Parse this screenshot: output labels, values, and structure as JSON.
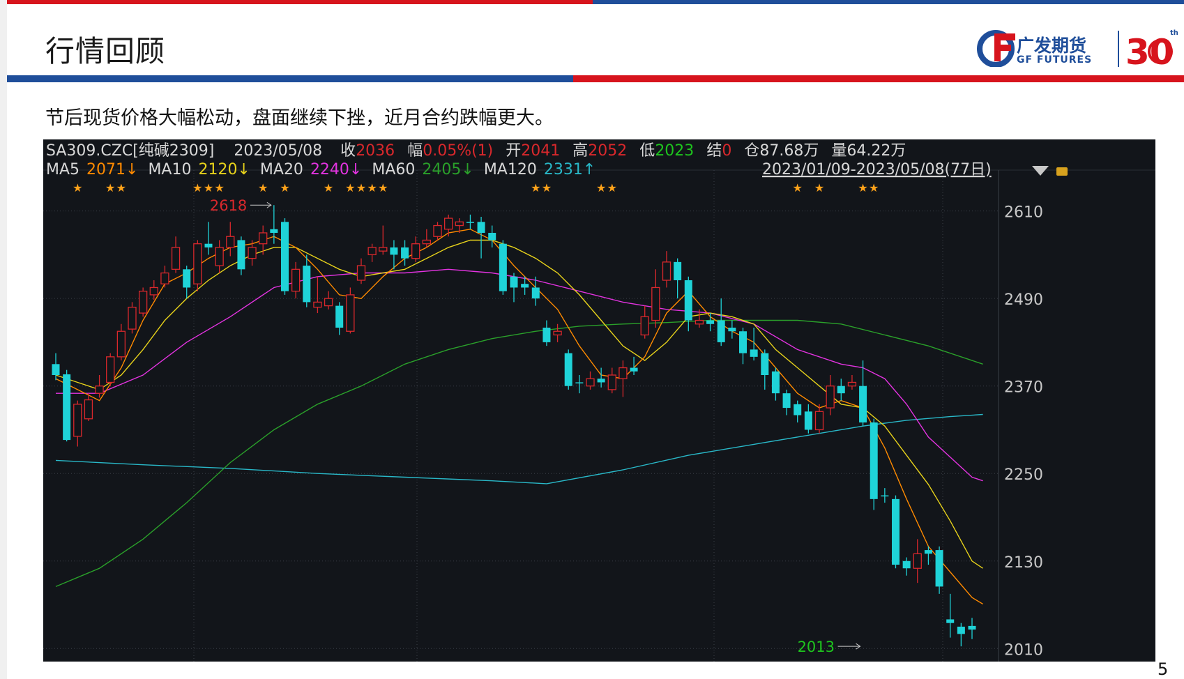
{
  "slide": {
    "title": "行情回顾",
    "subtitle": "节后现货价格大幅松动，盘面继续下挫，近月合约跌幅更大。",
    "page_number": "5",
    "logo_cn": "广发期货",
    "logo_en": "GF FUTURES",
    "logo_30": "30",
    "logo_th": "th"
  },
  "colors": {
    "up": "#d9282c",
    "down": "#1fd3d8",
    "ma5": "#ff8a00",
    "ma10": "#e7d21b",
    "ma20": "#e333e0",
    "ma60": "#2aa02a",
    "ma120": "#29b8c8",
    "text": "#d8d8d8",
    "star": "#ffa21a"
  },
  "chart_data": {
    "type": "candlestick",
    "header": {
      "symbol": "SA309.CZC[纯碱2309]",
      "date": "2023/05/08",
      "close_label": "收",
      "close": "2036",
      "change_label": "幅",
      "change": "0.05%(1)",
      "open_label": "开",
      "open": "2041",
      "high_label": "高",
      "high": "2052",
      "low_label": "低",
      "low": "2023",
      "settle_label": "结",
      "settle": "0",
      "oi_label": "仓",
      "oi": "87.68万",
      "volume_label": "量",
      "volume": "64.22万"
    },
    "ma_legend": [
      {
        "name": "MA5",
        "value": "2071↓",
        "color": "#ff8a00"
      },
      {
        "name": "MA10",
        "value": "2120↓",
        "color": "#e7d21b"
      },
      {
        "name": "MA20",
        "value": "2240↓",
        "color": "#e333e0"
      },
      {
        "name": "MA60",
        "value": "2405↓",
        "color": "#2aa02a"
      },
      {
        "name": "MA120",
        "value": "2331↑",
        "color": "#29b8c8"
      }
    ],
    "range_label": "2023/01/09-2023/05/08(77日)",
    "y_ticks": [
      2610,
      2490,
      2370,
      2250,
      2130,
      2010
    ],
    "ylim": [
      1995,
      2645
    ],
    "annotations": [
      {
        "label": "2618",
        "value": 2618,
        "index": 20
      },
      {
        "label": "2013",
        "value": 2013,
        "index": 74
      }
    ],
    "star_indices": [
      2,
      5,
      6,
      13,
      14,
      15,
      19,
      21,
      25,
      27,
      28,
      29,
      30,
      44,
      45,
      50,
      51,
      68,
      70,
      74,
      75
    ],
    "candles": [
      [
        2400,
        2385,
        2415,
        2378
      ],
      [
        2386,
        2296,
        2392,
        2294
      ],
      [
        2301,
        2345,
        2350,
        2287
      ],
      [
        2325,
        2351,
        2360,
        2322
      ],
      [
        2360,
        2370,
        2385,
        2354
      ],
      [
        2375,
        2410,
        2415,
        2370
      ],
      [
        2410,
        2445,
        2455,
        2405
      ],
      [
        2448,
        2478,
        2485,
        2442
      ],
      [
        2470,
        2500,
        2505,
        2465
      ],
      [
        2495,
        2505,
        2515,
        2488
      ],
      [
        2510,
        2525,
        2535,
        2505
      ],
      [
        2530,
        2560,
        2575,
        2525
      ],
      [
        2530,
        2505,
        2535,
        2490
      ],
      [
        2510,
        2565,
        2570,
        2500
      ],
      [
        2565,
        2560,
        2595,
        2550
      ],
      [
        2535,
        2560,
        2570,
        2525
      ],
      [
        2560,
        2575,
        2595,
        2548
      ],
      [
        2570,
        2530,
        2575,
        2522
      ],
      [
        2545,
        2560,
        2570,
        2535
      ],
      [
        2565,
        2580,
        2590,
        2550
      ],
      [
        2585,
        2580,
        2618,
        2565
      ],
      [
        2595,
        2500,
        2600,
        2495
      ],
      [
        2500,
        2530,
        2540,
        2490
      ],
      [
        2535,
        2485,
        2550,
        2478
      ],
      [
        2478,
        2485,
        2520,
        2470
      ],
      [
        2480,
        2490,
        2500,
        2475
      ],
      [
        2480,
        2450,
        2485,
        2440
      ],
      [
        2445,
        2495,
        2505,
        2442
      ],
      [
        2515,
        2535,
        2545,
        2510
      ],
      [
        2550,
        2560,
        2565,
        2540
      ],
      [
        2555,
        2560,
        2590,
        2550
      ],
      [
        2560,
        2550,
        2570,
        2530
      ],
      [
        2560,
        2545,
        2570,
        2535
      ],
      [
        2545,
        2565,
        2575,
        2540
      ],
      [
        2565,
        2570,
        2585,
        2560
      ],
      [
        2575,
        2590,
        2595,
        2570
      ],
      [
        2585,
        2600,
        2605,
        2575
      ],
      [
        2590,
        2595,
        2600,
        2580
      ],
      [
        2595,
        2595,
        2605,
        2585
      ],
      [
        2595,
        2580,
        2602,
        2545
      ],
      [
        2580,
        2570,
        2590,
        2560
      ],
      [
        2565,
        2500,
        2570,
        2495
      ],
      [
        2520,
        2505,
        2525,
        2485
      ],
      [
        2510,
        2505,
        2520,
        2495
      ],
      [
        2505,
        2490,
        2520,
        2480
      ],
      [
        2450,
        2430,
        2460,
        2425
      ],
      [
        2440,
        2445,
        2455,
        2430
      ],
      [
        2415,
        2370,
        2420,
        2365
      ],
      [
        2375,
        2375,
        2385,
        2360
      ],
      [
        2370,
        2380,
        2390,
        2365
      ],
      [
        2380,
        2375,
        2395,
        2368
      ],
      [
        2365,
        2385,
        2395,
        2360
      ],
      [
        2380,
        2395,
        2405,
        2355
      ],
      [
        2395,
        2390,
        2410,
        2385
      ],
      [
        2440,
        2465,
        2480,
        2435
      ],
      [
        2460,
        2505,
        2530,
        2450
      ],
      [
        2515,
        2540,
        2555,
        2505
      ],
      [
        2540,
        2515,
        2545,
        2490
      ],
      [
        2515,
        2460,
        2520,
        2445
      ],
      [
        2455,
        2460,
        2475,
        2450
      ],
      [
        2460,
        2455,
        2470,
        2445
      ],
      [
        2460,
        2430,
        2490,
        2425
      ],
      [
        2450,
        2445,
        2460,
        2435
      ],
      [
        2445,
        2415,
        2450,
        2400
      ],
      [
        2420,
        2410,
        2450,
        2405
      ],
      [
        2415,
        2385,
        2420,
        2365
      ],
      [
        2390,
        2360,
        2395,
        2350
      ],
      [
        2360,
        2340,
        2365,
        2330
      ],
      [
        2345,
        2330,
        2350,
        2320
      ],
      [
        2335,
        2310,
        2345,
        2305
      ],
      [
        2310,
        2335,
        2345,
        2305
      ],
      [
        2340,
        2370,
        2385,
        2330
      ],
      [
        2370,
        2360,
        2380,
        2350
      ],
      [
        2370,
        2375,
        2385,
        2365
      ],
      [
        2370,
        2320,
        2405,
        2315
      ],
      [
        2320,
        2215,
        2325,
        2200
      ],
      [
        2220,
        2220,
        2230,
        2210
      ],
      [
        2215,
        2125,
        2220,
        2120
      ],
      [
        2130,
        2120,
        2135,
        2110
      ],
      [
        2120,
        2140,
        2160,
        2100
      ],
      [
        2145,
        2140,
        2150,
        2125
      ],
      [
        2145,
        2095,
        2150,
        2085
      ],
      [
        2050,
        2045,
        2085,
        2025
      ],
      [
        2040,
        2030,
        2045,
        2013
      ],
      [
        2041,
        2036,
        2052,
        2023
      ]
    ],
    "ma5": [
      [
        0,
        2380
      ],
      [
        2,
        2365
      ],
      [
        4,
        2350
      ],
      [
        6,
        2395
      ],
      [
        8,
        2460
      ],
      [
        10,
        2510
      ],
      [
        12,
        2525
      ],
      [
        14,
        2545
      ],
      [
        16,
        2560
      ],
      [
        18,
        2565
      ],
      [
        20,
        2575
      ],
      [
        22,
        2560
      ],
      [
        24,
        2530
      ],
      [
        26,
        2495
      ],
      [
        28,
        2490
      ],
      [
        30,
        2520
      ],
      [
        32,
        2545
      ],
      [
        34,
        2560
      ],
      [
        36,
        2580
      ],
      [
        38,
        2585
      ],
      [
        40,
        2570
      ],
      [
        42,
        2535
      ],
      [
        44,
        2505
      ],
      [
        46,
        2475
      ],
      [
        48,
        2425
      ],
      [
        50,
        2385
      ],
      [
        52,
        2380
      ],
      [
        54,
        2410
      ],
      [
        56,
        2470
      ],
      [
        58,
        2500
      ],
      [
        60,
        2465
      ],
      [
        62,
        2445
      ],
      [
        64,
        2430
      ],
      [
        66,
        2395
      ],
      [
        68,
        2360
      ],
      [
        70,
        2340
      ],
      [
        72,
        2350
      ],
      [
        74,
        2340
      ],
      [
        76,
        2285
      ],
      [
        78,
        2215
      ],
      [
        80,
        2150
      ],
      [
        82,
        2115
      ],
      [
        84,
        2080
      ],
      [
        85,
        2071
      ]
    ],
    "ma10": [
      [
        0,
        2385
      ],
      [
        2,
        2375
      ],
      [
        4,
        2365
      ],
      [
        6,
        2385
      ],
      [
        8,
        2420
      ],
      [
        10,
        2460
      ],
      [
        12,
        2490
      ],
      [
        14,
        2515
      ],
      [
        16,
        2535
      ],
      [
        18,
        2550
      ],
      [
        20,
        2560
      ],
      [
        22,
        2560
      ],
      [
        24,
        2545
      ],
      [
        26,
        2530
      ],
      [
        28,
        2520
      ],
      [
        30,
        2525
      ],
      [
        32,
        2530
      ],
      [
        34,
        2545
      ],
      [
        36,
        2560
      ],
      [
        38,
        2570
      ],
      [
        40,
        2570
      ],
      [
        42,
        2560
      ],
      [
        44,
        2545
      ],
      [
        46,
        2525
      ],
      [
        48,
        2495
      ],
      [
        50,
        2460
      ],
      [
        52,
        2425
      ],
      [
        54,
        2405
      ],
      [
        56,
        2430
      ],
      [
        58,
        2465
      ],
      [
        60,
        2470
      ],
      [
        62,
        2465
      ],
      [
        64,
        2455
      ],
      [
        66,
        2420
      ],
      [
        68,
        2395
      ],
      [
        70,
        2370
      ],
      [
        72,
        2345
      ],
      [
        74,
        2340
      ],
      [
        76,
        2315
      ],
      [
        78,
        2275
      ],
      [
        80,
        2235
      ],
      [
        82,
        2185
      ],
      [
        84,
        2130
      ],
      [
        85,
        2120
      ]
    ],
    "ma20": [
      [
        0,
        2360
      ],
      [
        4,
        2360
      ],
      [
        8,
        2385
      ],
      [
        12,
        2430
      ],
      [
        16,
        2465
      ],
      [
        20,
        2505
      ],
      [
        24,
        2520
      ],
      [
        28,
        2525
      ],
      [
        32,
        2525
      ],
      [
        36,
        2530
      ],
      [
        40,
        2525
      ],
      [
        44,
        2515
      ],
      [
        48,
        2500
      ],
      [
        52,
        2485
      ],
      [
        56,
        2475
      ],
      [
        60,
        2470
      ],
      [
        64,
        2455
      ],
      [
        68,
        2420
      ],
      [
        72,
        2400
      ],
      [
        74,
        2395
      ],
      [
        76,
        2380
      ],
      [
        78,
        2345
      ],
      [
        80,
        2300
      ],
      [
        84,
        2245
      ],
      [
        85,
        2240
      ]
    ],
    "ma60": [
      [
        0,
        2095
      ],
      [
        4,
        2120
      ],
      [
        8,
        2160
      ],
      [
        12,
        2210
      ],
      [
        16,
        2265
      ],
      [
        20,
        2310
      ],
      [
        24,
        2345
      ],
      [
        28,
        2370
      ],
      [
        32,
        2400
      ],
      [
        36,
        2420
      ],
      [
        40,
        2435
      ],
      [
        44,
        2445
      ],
      [
        48,
        2452
      ],
      [
        52,
        2455
      ],
      [
        56,
        2457
      ],
      [
        60,
        2460
      ],
      [
        64,
        2460
      ],
      [
        68,
        2460
      ],
      [
        72,
        2455
      ],
      [
        76,
        2440
      ],
      [
        80,
        2425
      ],
      [
        84,
        2405
      ],
      [
        85,
        2400
      ]
    ],
    "ma120": [
      [
        0,
        2268
      ],
      [
        8,
        2262
      ],
      [
        16,
        2257
      ],
      [
        24,
        2250
      ],
      [
        32,
        2245
      ],
      [
        40,
        2240
      ],
      [
        45,
        2236
      ],
      [
        52,
        2255
      ],
      [
        58,
        2275
      ],
      [
        64,
        2290
      ],
      [
        70,
        2305
      ],
      [
        74,
        2315
      ],
      [
        78,
        2323
      ],
      [
        82,
        2328
      ],
      [
        85,
        2331
      ]
    ]
  }
}
